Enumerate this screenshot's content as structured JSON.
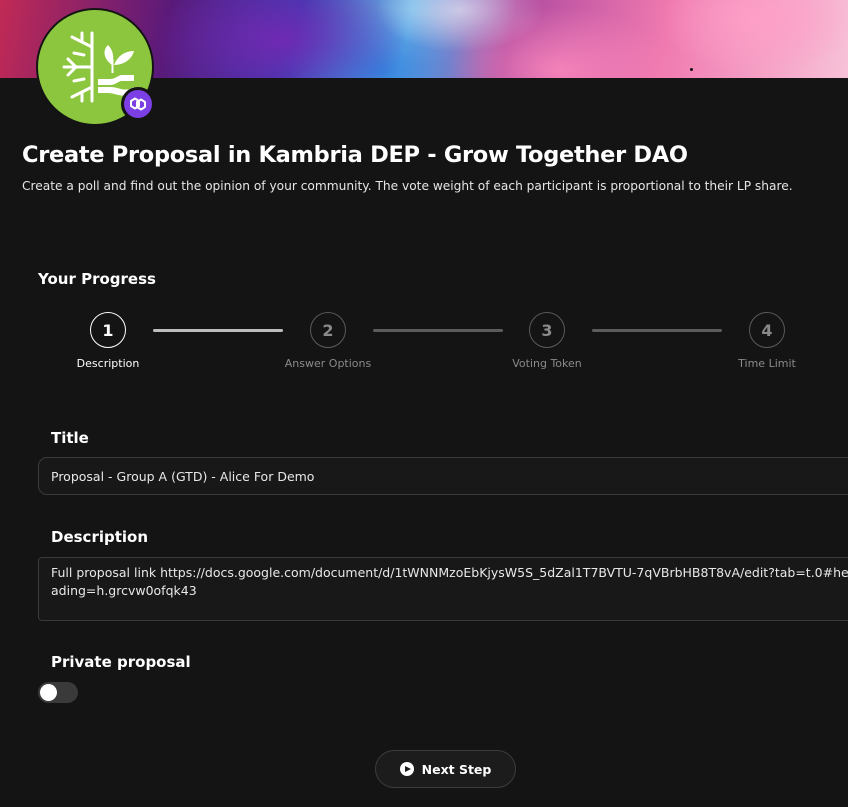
{
  "header": {
    "title": "Create Proposal in Kambria DEP - Grow Together DAO",
    "subtitle": "Create a poll and find out the opinion of your community. The vote weight of each participant is proportional to their LP share.",
    "avatar_icon": "leaf-snowflake-logo",
    "chain_icon": "polygon-icon",
    "brand_color": "#8cc63f",
    "chain_color": "#7b3fe4"
  },
  "progress": {
    "heading": "Your Progress",
    "current_step": 1,
    "steps": [
      {
        "number": "1",
        "label": "Description"
      },
      {
        "number": "2",
        "label": "Answer Options"
      },
      {
        "number": "3",
        "label": "Voting Token"
      },
      {
        "number": "4",
        "label": "Time Limit"
      }
    ]
  },
  "form": {
    "title_label": "Title",
    "title_value": "Proposal - Group A (GTD) - Alice For Demo",
    "description_label": "Description",
    "description_value": "Full proposal link https://docs.google.com/document/d/1tWNNMzoEbKjysW5S_5dZal1T7BVTU-7qVBrbHB8T8vA/edit?tab=t.0#heading=h.grcvw0ofqk43",
    "private_label": "Private proposal",
    "private_enabled": false
  },
  "actions": {
    "next_label": "Next Step"
  }
}
